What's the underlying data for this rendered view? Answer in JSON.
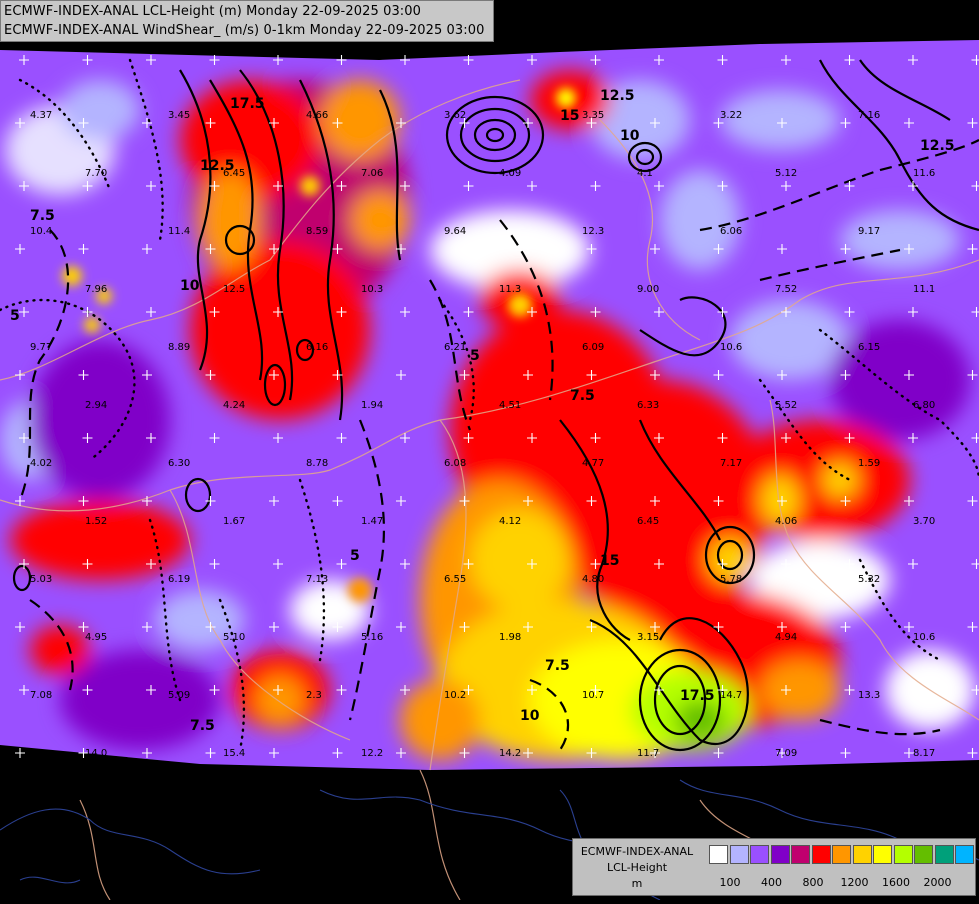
{
  "header": {
    "line1": "ECMWF-INDEX-ANAL LCL-Height (m) Monday 22-09-2025 03:00",
    "line2": "ECMWF-INDEX-ANAL WindShear_ (m/s) 0-1km Monday 22-09-2025 03:00"
  },
  "legend": {
    "model": "ECMWF-INDEX-ANAL",
    "variable": "LCL-Height",
    "unit": "m",
    "colors": [
      "#ffffff",
      "#b4b4ff",
      "#9a50ff",
      "#8000c8",
      "#c0006e",
      "#ff0000",
      "#ff9600",
      "#ffd200",
      "#ffff00",
      "#b4ff00",
      "#64be00",
      "#00a07a",
      "#00b4ff"
    ],
    "ticks": [
      "100",
      "400",
      "800",
      "1200",
      "1600",
      "2000"
    ]
  },
  "map": {
    "station_values": [
      "4.37",
      "3.45",
      "4.66",
      "3.62",
      "3.35",
      "3.22",
      "7.16",
      "7.70",
      "6.45",
      "7.06",
      "4.09",
      "4.1",
      "5.12",
      "11.6",
      "10.4",
      "11.4",
      "8.59",
      "9.64",
      "12.3",
      "6.06",
      "9.17",
      "7.96",
      "12.5",
      "10.3",
      "11.3",
      "9.00",
      "7.52",
      "11.1",
      "9.77",
      "8.89",
      "6.16",
      "6.21",
      "6.09",
      "10.6",
      "6.15",
      "2.94",
      "4.24",
      "1.94",
      "4.51",
      "6.33",
      "5.52",
      "6.80",
      "4.02",
      "6.30",
      "8.78",
      "6.08",
      "4.77",
      "7.17",
      "1.59",
      "1.52",
      "1.67",
      "1.47",
      "4.12",
      "6.45",
      "4.06",
      "3.70",
      "5.03",
      "6.19",
      "7.13",
      "6.55",
      "4.80",
      "5.78",
      "5.32",
      "4.95",
      "5.10",
      "5.16",
      "1.98",
      "3.15",
      "4.94",
      "10.6",
      "7.08",
      "5.09",
      "2.3",
      "10.2",
      "10.7",
      "14.7",
      "13.3",
      "14.0",
      "15.4",
      "12.2",
      "14.2",
      "11.7",
      "7.09",
      "8.17"
    ],
    "contour_labels": [
      "17.5",
      "12.5",
      "10",
      "7.5",
      "5",
      "15",
      "12.5",
      "10",
      "7.5",
      "5",
      "15",
      "17.5",
      "7.5",
      "10",
      "12.5",
      "7.5",
      "5"
    ]
  }
}
